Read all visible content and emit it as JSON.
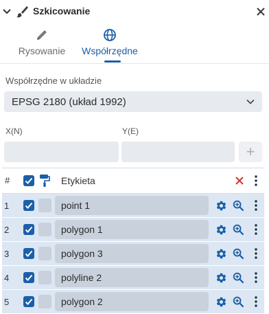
{
  "header": {
    "title": "Szkicowanie"
  },
  "tabs": [
    {
      "label": "Rysowanie",
      "icon": "pencil-icon",
      "active": false
    },
    {
      "label": "Współrzędne",
      "icon": "globe-icon",
      "active": true
    }
  ],
  "crs": {
    "label": "Współrzędne w układzie",
    "value": "EPSG 2180 (układ 1992)"
  },
  "coords": {
    "x_label": "X(N)",
    "y_label": "Y(E)",
    "x_value": "",
    "y_value": "",
    "add_label": "+"
  },
  "table": {
    "hash": "#",
    "label_header": "Etykieta",
    "rows": [
      {
        "num": "1",
        "label": "point 1",
        "checked": true
      },
      {
        "num": "2",
        "label": "polygon 1",
        "checked": true
      },
      {
        "num": "3",
        "label": "polygon 3",
        "checked": true
      },
      {
        "num": "4",
        "label": "polyline 2",
        "checked": true
      },
      {
        "num": "5",
        "label": "polygon 2",
        "checked": true
      }
    ]
  },
  "colors": {
    "accent": "#1b5fa8",
    "row_bg": "#dce7f3",
    "danger": "#d9302c"
  }
}
